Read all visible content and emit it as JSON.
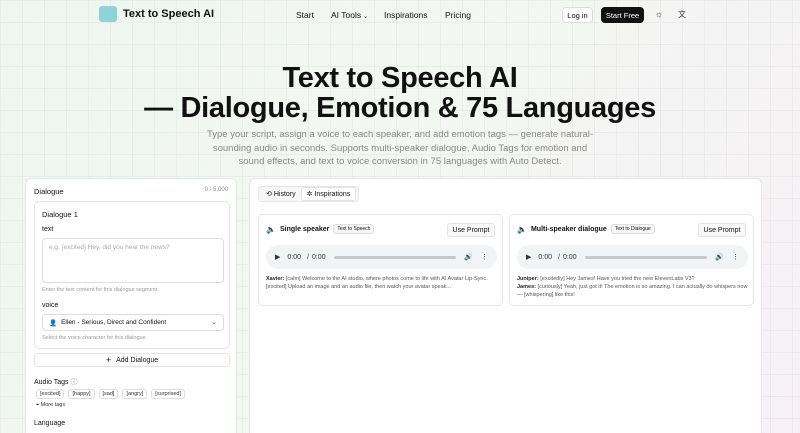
{
  "nav": {
    "logo_text": "Text to Speech AI",
    "links": [
      "Start",
      "AI Tools",
      "Inspirations",
      "Pricing"
    ],
    "login": "Log in",
    "start_free": "Start Free"
  },
  "hero": {
    "title_line1": "Text to Speech AI",
    "title_line2": "— Dialogue, Emotion & 75 Languages",
    "subtitle": "Type your script, assign a voice to each speaker, and add emotion tags — generate natural-sounding audio in seconds. Supports multi-speaker dialogue, Audio Tags for emotion and sound effects, and text to voice conversion in 75 languages with Auto Detect."
  },
  "editor": {
    "label": "Dialogue",
    "count": "0 / 5,000",
    "card_title": "Dialogue 1",
    "text_label": "text",
    "text_placeholder": "e.g. [excited] Hey, did you hear the news?",
    "text_hint": "Enter the text content for this dialogue segment.",
    "voice_label": "voice",
    "voice_value": "Ellen - Serious, Direct and Confident",
    "voice_hint": "Select the voice character for this dialogue.",
    "add_button": "Add Dialogue",
    "audio_tags_label": "Audio Tags",
    "tags": [
      "[excited]",
      "[happy]",
      "[sad]",
      "[angry]",
      "[surprised]"
    ],
    "more_tags": "More tags",
    "language_label": "Language"
  },
  "panel": {
    "tabs": [
      "History",
      "Inspirations"
    ],
    "cards": [
      {
        "title": "Single speaker",
        "badge": "Text to Speech",
        "button": "Use Prompt",
        "time": "0:00",
        "lines": [
          {
            "speaker": "Xavier:",
            "text": "[calm] Welcome to the AI studio, where photos come to life with AI Avatar Lip-Sync. [excited] Upload an image and an audio file, then watch your avatar speak..."
          }
        ]
      },
      {
        "title": "Multi-speaker dialogue",
        "badge": "Text to Dialogue",
        "button": "Use Prompt",
        "time": "0:00",
        "lines": [
          {
            "speaker": "Juniper:",
            "text": "[excitedly] Hey James! Have you tried the new ElevenLabs V3?"
          },
          {
            "speaker": "James:",
            "text": "[curiously] Yeah, just got it! The emotion is so amazing. I can actually do whispers now— [whispering] like this!"
          }
        ]
      }
    ]
  }
}
